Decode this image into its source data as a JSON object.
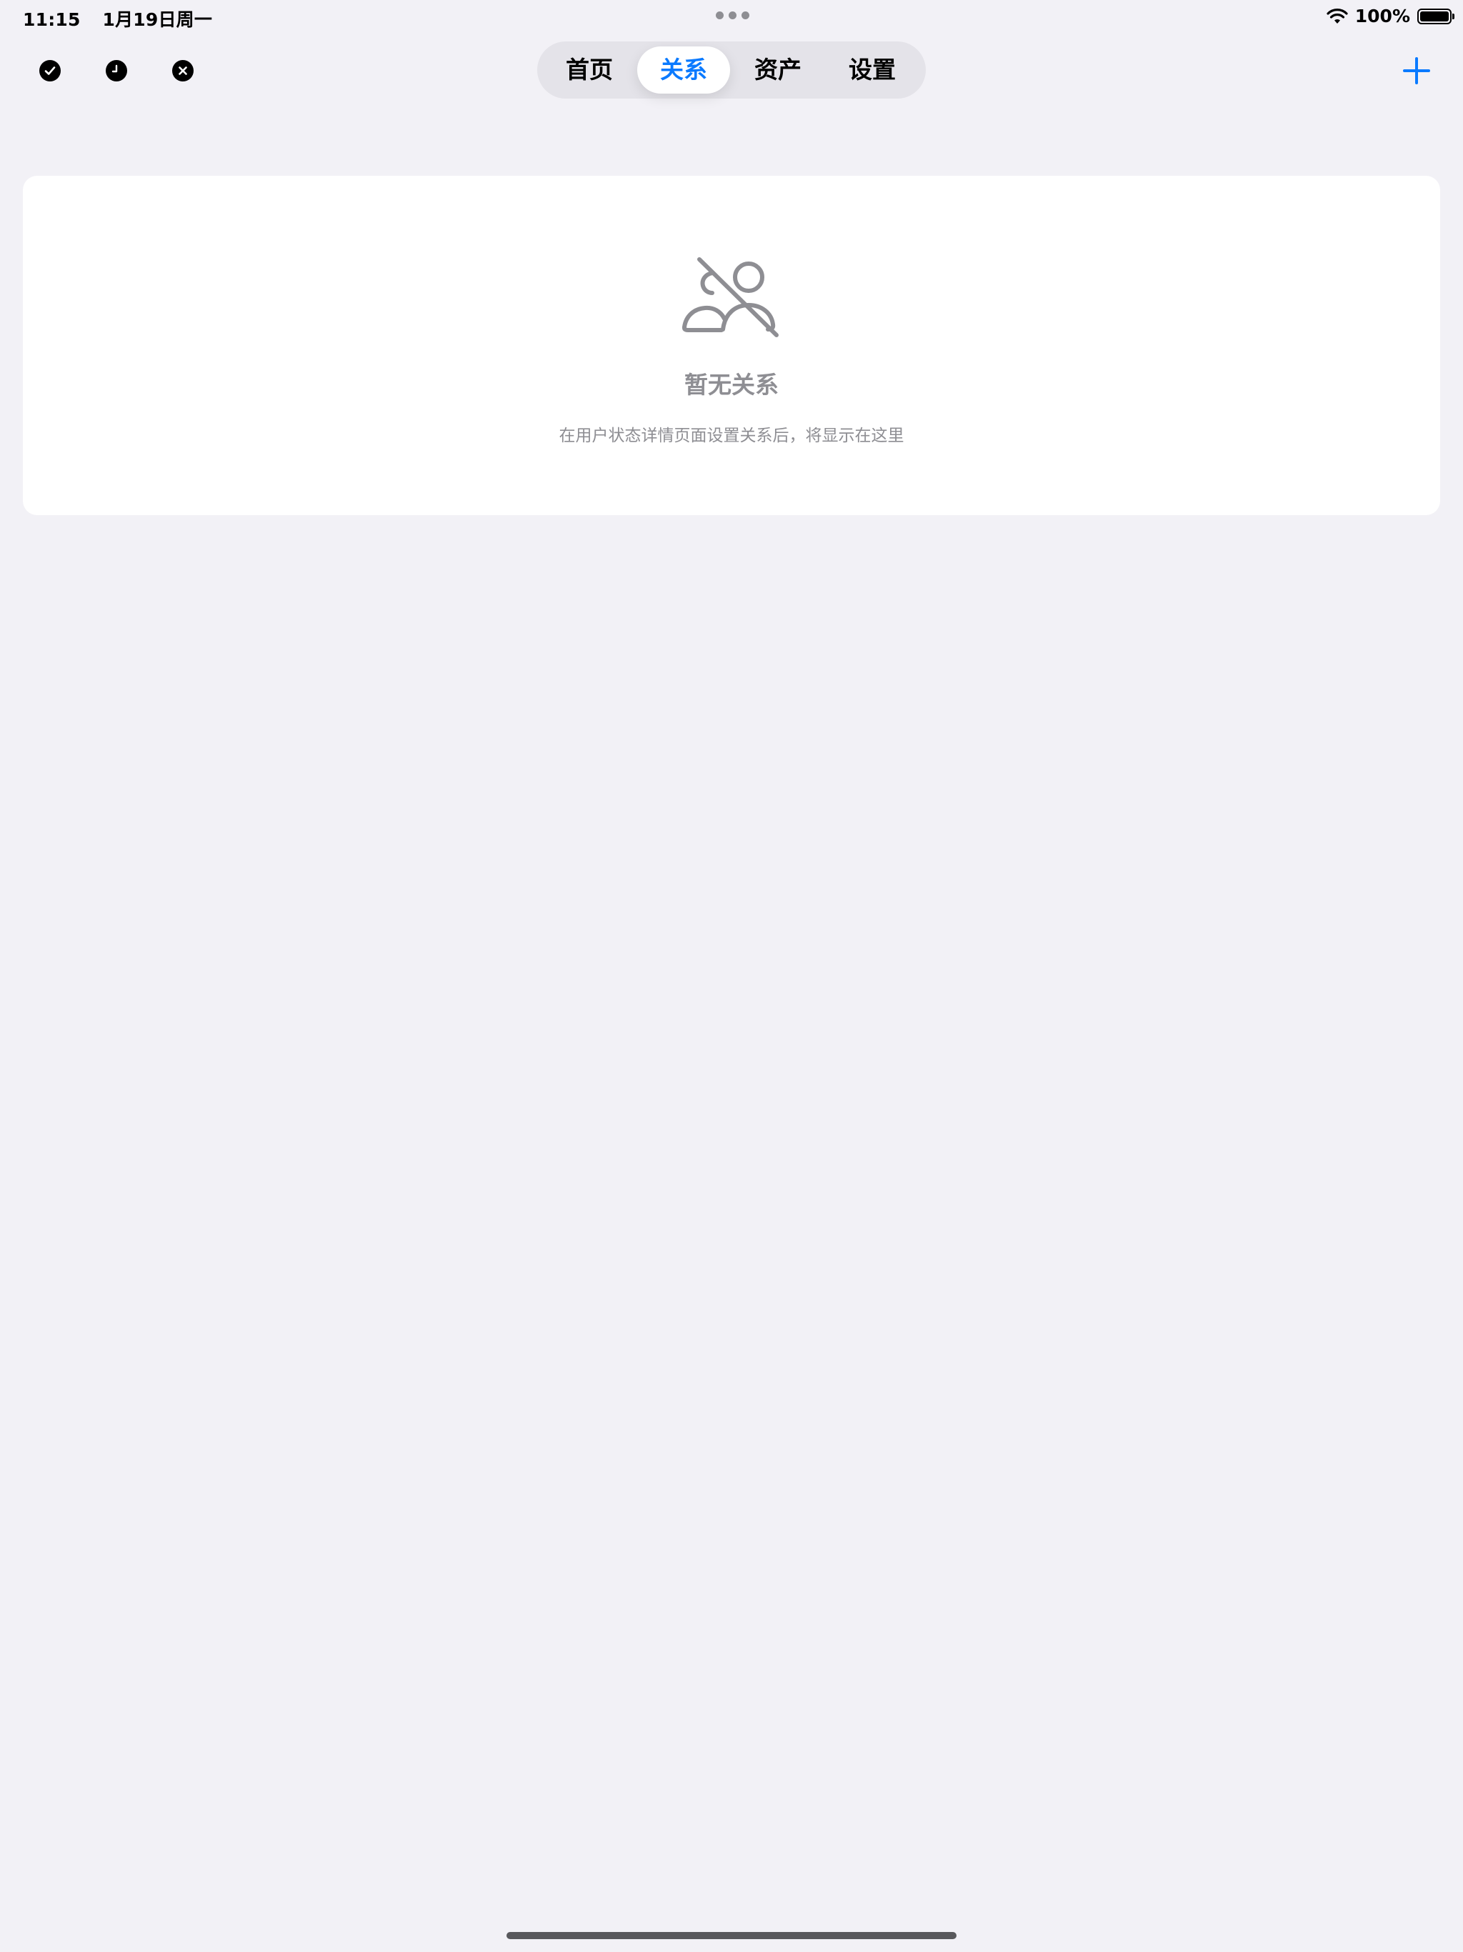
{
  "status_bar": {
    "time": "11:15",
    "date": "1月19日周一",
    "battery": "100%"
  },
  "toolbar": {
    "left_icons": [
      "checkmark-circle-icon",
      "clock-icon",
      "close-circle-icon"
    ],
    "tabs": [
      {
        "label": "首页",
        "active": false
      },
      {
        "label": "关系",
        "active": true
      },
      {
        "label": "资产",
        "active": false
      },
      {
        "label": "设置",
        "active": false
      }
    ],
    "add_icon": "plus-icon"
  },
  "empty_state": {
    "icon": "person-2-slash-icon",
    "title": "暂无关系",
    "description": "在用户状态详情页面设置关系后，将显示在这里"
  },
  "colors": {
    "background": "#f2f1f6",
    "accent": "#0a7aff",
    "secondary_text": "#8e8e93",
    "card": "#ffffff"
  }
}
